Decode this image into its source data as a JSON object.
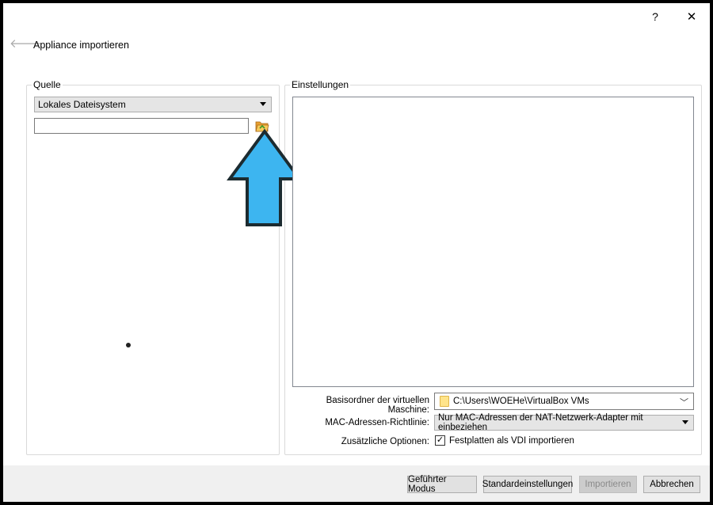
{
  "window": {
    "help_glyph": "?",
    "close_glyph": "✕",
    "back_glyph": "🡐"
  },
  "header": {
    "title": "Appliance importieren"
  },
  "source": {
    "legend": "Quelle",
    "selected": "Lokales Dateisystem",
    "file_value": ""
  },
  "settings": {
    "legend": "Einstellungen",
    "base_folder_label": "Basisordner der virtuellen Maschine:",
    "base_folder_value": "C:\\Users\\WOEHe\\VirtualBox VMs",
    "mac_label": "MAC-Adressen-Richtlinie:",
    "mac_value": "Nur MAC-Adressen der NAT-Netzwerk-Adapter mit einbeziehen",
    "options_label": "Zusätzliche Optionen:",
    "vdi_checkbox_label": "Festplatten als VDI importieren",
    "vdi_checked": true,
    "check_glyph": "✓"
  },
  "buttons": {
    "guided": "Geführter Modus",
    "defaults": "Standardeinstellungen",
    "import": "Importieren",
    "cancel": "Abbrechen"
  },
  "colors": {
    "annotation_arrow": "#3db5f0",
    "annotation_outline": "#1c2b30",
    "folder_icon": "#f0a830"
  },
  "icons": {
    "folder_button": "folder-open-icon",
    "annotation": "arrow-up-icon"
  }
}
